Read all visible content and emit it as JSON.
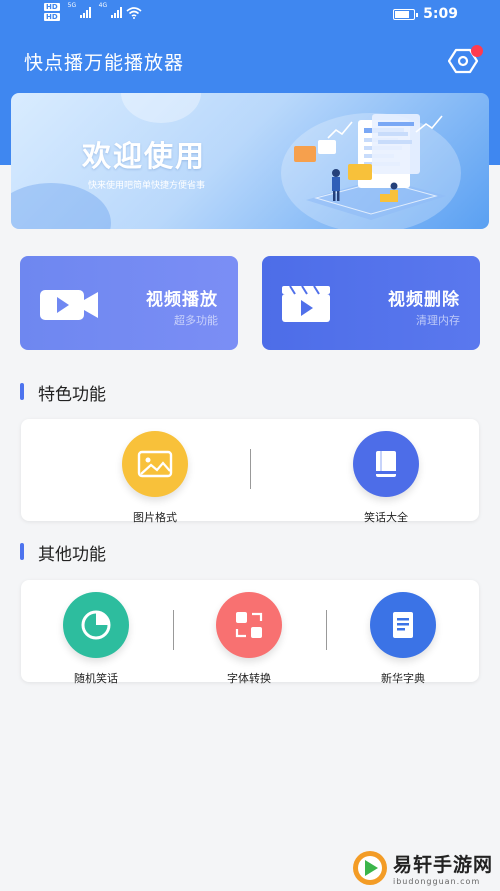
{
  "status_bar": {
    "hd1": "HD",
    "hd2": "HD",
    "net1": "5G",
    "net2": "4G",
    "time": "5:09"
  },
  "header": {
    "title": "快点播万能播放器",
    "settings_icon": "hexagon-gear-icon"
  },
  "banner": {
    "title": "欢迎使用",
    "subtitle": "快来使用吧简单快捷方便省事",
    "illustration": "data-dashboard-illustration"
  },
  "cards": [
    {
      "title": "视频播放",
      "subtitle": "超多功能",
      "icon": "video-camera-icon",
      "color": "#7088f2"
    },
    {
      "title": "视频删除",
      "subtitle": "清理内存",
      "icon": "clapperboard-icon",
      "color": "#5070ea"
    }
  ],
  "sections": [
    {
      "title": "特色功能",
      "items": [
        {
          "label": "图片格式",
          "icon": "image-icon",
          "color": "#f8c13a"
        },
        {
          "label": "笑话大全",
          "icon": "book-icon",
          "color": "#4d6de8"
        }
      ]
    },
    {
      "title": "其他功能",
      "items": [
        {
          "label": "随机笑话",
          "icon": "pie-chart-icon",
          "color": "#2dbd9e"
        },
        {
          "label": "字体转换",
          "icon": "convert-icon",
          "color": "#f87171"
        },
        {
          "label": "新华字典",
          "icon": "dictionary-icon",
          "color": "#3b73e6"
        }
      ]
    }
  ],
  "watermark": {
    "name": "易轩手游网",
    "domain": "ibudongguan.com"
  },
  "colors": {
    "primary": "#3f87f0",
    "accent": "#4d73ee",
    "badge": "#ff3b4f"
  }
}
